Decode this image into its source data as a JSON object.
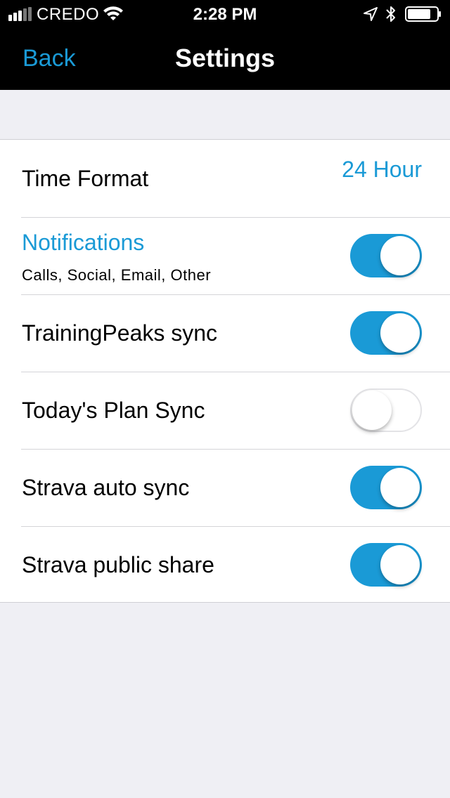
{
  "status_bar": {
    "carrier": "CREDO",
    "time": "2:28 PM",
    "icons": [
      "signal-icon",
      "wifi-icon",
      "location-arrow-icon",
      "bluetooth-icon",
      "battery-icon"
    ]
  },
  "nav": {
    "back_label": "Back",
    "title": "Settings"
  },
  "colors": {
    "accent": "#1a9ad6",
    "nav_background": "#000000",
    "page_background": "#efeff4"
  },
  "settings": {
    "time_format": {
      "label": "Time Format",
      "value": "24 Hour"
    },
    "notifications": {
      "label": "Notifications",
      "sublabel": "Calls, Social, Email, Other",
      "on": true
    },
    "trainingpeaks_sync": {
      "label": "TrainingPeaks sync",
      "on": true
    },
    "todays_plan_sync": {
      "label": "Today's Plan Sync",
      "on": false
    },
    "strava_auto_sync": {
      "label": "Strava auto sync",
      "on": true
    },
    "strava_public_share": {
      "label": "Strava public share",
      "on": true
    }
  }
}
